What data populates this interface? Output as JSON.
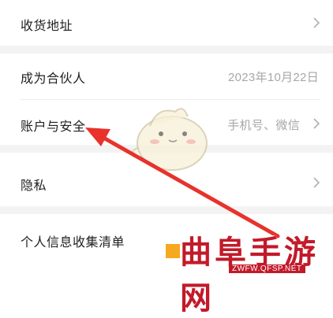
{
  "rows": [
    {
      "label": "收货地址",
      "value": "",
      "chevron": true
    },
    {
      "label": "成为合伙人",
      "value": "2023年10月22日",
      "chevron": false
    },
    {
      "label": "账户与安全",
      "value": "手机号、微信",
      "chevron": true
    },
    {
      "label": "隐私",
      "value": "",
      "chevron": true
    },
    {
      "label": "个人信息收集清单",
      "value": "",
      "chevron": false
    }
  ],
  "watermark": {
    "title": "曲阜手游网",
    "url": "ZWFW.QFSP.NET"
  },
  "colors": {
    "arrow": "#e8322b",
    "section_gap": "#f3f3f3",
    "value_text": "#a7a7a7",
    "watermark_red": "#c21a2a"
  },
  "icons": {
    "chevron": "chevron-right-icon",
    "mascot": "mascot-sticker",
    "arrow": "annotation-arrow"
  }
}
